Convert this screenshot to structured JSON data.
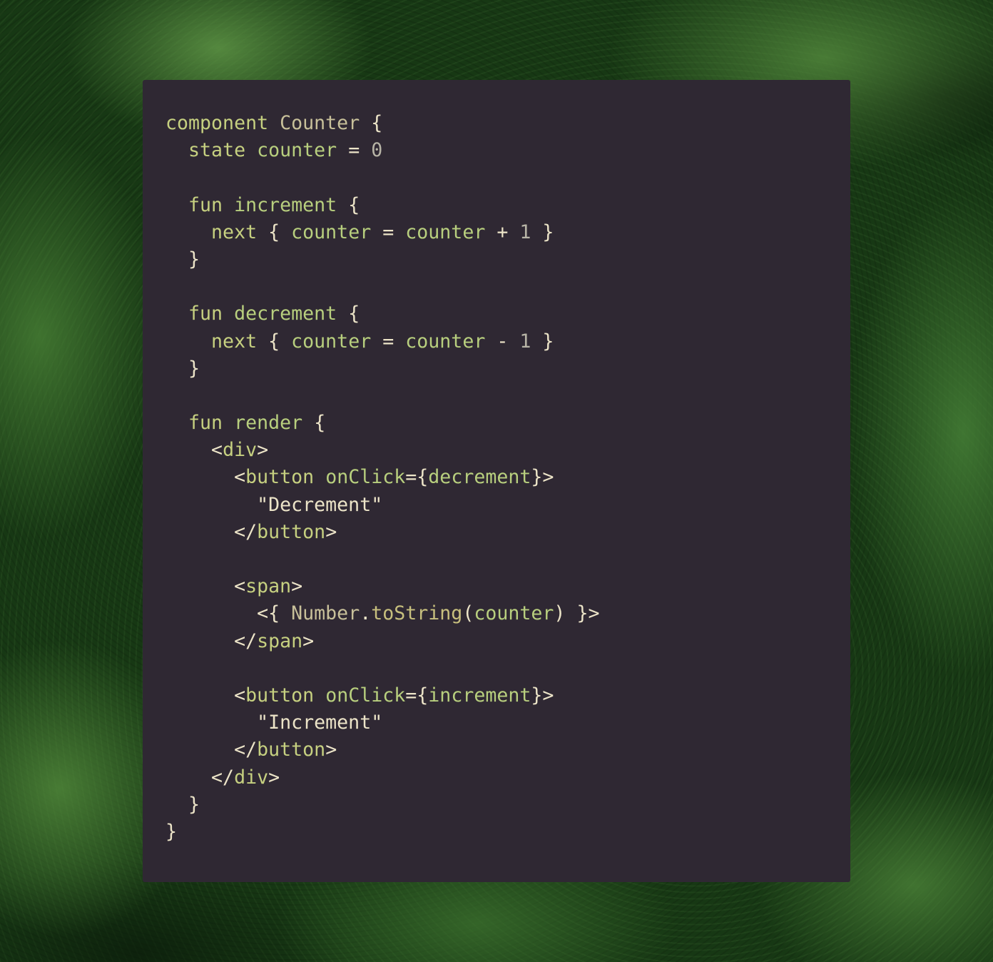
{
  "code": {
    "lines": [
      [
        [
          "keyword",
          "component"
        ],
        [
          "plain",
          " "
        ],
        [
          "type",
          "Counter"
        ],
        [
          "plain",
          " "
        ],
        [
          "punct",
          "{"
        ]
      ],
      [
        [
          "plain",
          "  "
        ],
        [
          "keyword",
          "state"
        ],
        [
          "plain",
          " "
        ],
        [
          "ident",
          "counter"
        ],
        [
          "plain",
          " "
        ],
        [
          "punct",
          "="
        ],
        [
          "plain",
          " "
        ],
        [
          "number",
          "0"
        ]
      ],
      [],
      [
        [
          "plain",
          "  "
        ],
        [
          "keyword",
          "fun"
        ],
        [
          "plain",
          " "
        ],
        [
          "ident",
          "increment"
        ],
        [
          "plain",
          " "
        ],
        [
          "punct",
          "{"
        ]
      ],
      [
        [
          "plain",
          "    "
        ],
        [
          "keyword",
          "next"
        ],
        [
          "plain",
          " "
        ],
        [
          "punct",
          "{"
        ],
        [
          "plain",
          " "
        ],
        [
          "ident",
          "counter"
        ],
        [
          "plain",
          " "
        ],
        [
          "punct",
          "="
        ],
        [
          "plain",
          " "
        ],
        [
          "ident",
          "counter"
        ],
        [
          "plain",
          " "
        ],
        [
          "punct",
          "+"
        ],
        [
          "plain",
          " "
        ],
        [
          "number",
          "1"
        ],
        [
          "plain",
          " "
        ],
        [
          "punct",
          "}"
        ]
      ],
      [
        [
          "plain",
          "  "
        ],
        [
          "punct",
          "}"
        ]
      ],
      [],
      [
        [
          "plain",
          "  "
        ],
        [
          "keyword",
          "fun"
        ],
        [
          "plain",
          " "
        ],
        [
          "ident",
          "decrement"
        ],
        [
          "plain",
          " "
        ],
        [
          "punct",
          "{"
        ]
      ],
      [
        [
          "plain",
          "    "
        ],
        [
          "keyword",
          "next"
        ],
        [
          "plain",
          " "
        ],
        [
          "punct",
          "{"
        ],
        [
          "plain",
          " "
        ],
        [
          "ident",
          "counter"
        ],
        [
          "plain",
          " "
        ],
        [
          "punct",
          "="
        ],
        [
          "plain",
          " "
        ],
        [
          "ident",
          "counter"
        ],
        [
          "plain",
          " "
        ],
        [
          "punct",
          "-"
        ],
        [
          "plain",
          " "
        ],
        [
          "number",
          "1"
        ],
        [
          "plain",
          " "
        ],
        [
          "punct",
          "}"
        ]
      ],
      [
        [
          "plain",
          "  "
        ],
        [
          "punct",
          "}"
        ]
      ],
      [],
      [
        [
          "plain",
          "  "
        ],
        [
          "keyword",
          "fun"
        ],
        [
          "plain",
          " "
        ],
        [
          "ident",
          "render"
        ],
        [
          "plain",
          " "
        ],
        [
          "punct",
          "{"
        ]
      ],
      [
        [
          "plain",
          "    "
        ],
        [
          "punct",
          "<"
        ],
        [
          "tag",
          "div"
        ],
        [
          "punct",
          ">"
        ]
      ],
      [
        [
          "plain",
          "      "
        ],
        [
          "punct",
          "<"
        ],
        [
          "tag",
          "button"
        ],
        [
          "plain",
          " "
        ],
        [
          "ident",
          "onClick"
        ],
        [
          "punct",
          "={"
        ],
        [
          "ident",
          "decrement"
        ],
        [
          "punct",
          "}>"
        ]
      ],
      [
        [
          "plain",
          "        "
        ],
        [
          "string",
          "\"Decrement\""
        ]
      ],
      [
        [
          "plain",
          "      "
        ],
        [
          "punct",
          "</"
        ],
        [
          "tag",
          "button"
        ],
        [
          "punct",
          ">"
        ]
      ],
      [],
      [
        [
          "plain",
          "      "
        ],
        [
          "punct",
          "<"
        ],
        [
          "tag",
          "span"
        ],
        [
          "punct",
          ">"
        ]
      ],
      [
        [
          "plain",
          "        "
        ],
        [
          "punct",
          "<{"
        ],
        [
          "plain",
          " "
        ],
        [
          "type",
          "Number"
        ],
        [
          "punct",
          "."
        ],
        [
          "method",
          "toString"
        ],
        [
          "punct",
          "("
        ],
        [
          "ident",
          "counter"
        ],
        [
          "punct",
          ")"
        ],
        [
          "plain",
          " "
        ],
        [
          "punct",
          "}>"
        ]
      ],
      [
        [
          "plain",
          "      "
        ],
        [
          "punct",
          "</"
        ],
        [
          "tag",
          "span"
        ],
        [
          "punct",
          ">"
        ]
      ],
      [],
      [
        [
          "plain",
          "      "
        ],
        [
          "punct",
          "<"
        ],
        [
          "tag",
          "button"
        ],
        [
          "plain",
          " "
        ],
        [
          "ident",
          "onClick"
        ],
        [
          "punct",
          "={"
        ],
        [
          "ident",
          "increment"
        ],
        [
          "punct",
          "}>"
        ]
      ],
      [
        [
          "plain",
          "        "
        ],
        [
          "string",
          "\"Increment\""
        ]
      ],
      [
        [
          "plain",
          "      "
        ],
        [
          "punct",
          "</"
        ],
        [
          "tag",
          "button"
        ],
        [
          "punct",
          ">"
        ]
      ],
      [
        [
          "plain",
          "    "
        ],
        [
          "punct",
          "</"
        ],
        [
          "tag",
          "div"
        ],
        [
          "punct",
          ">"
        ]
      ],
      [
        [
          "plain",
          "  "
        ],
        [
          "punct",
          "}"
        ]
      ],
      [
        [
          "punct",
          "}"
        ]
      ]
    ]
  }
}
